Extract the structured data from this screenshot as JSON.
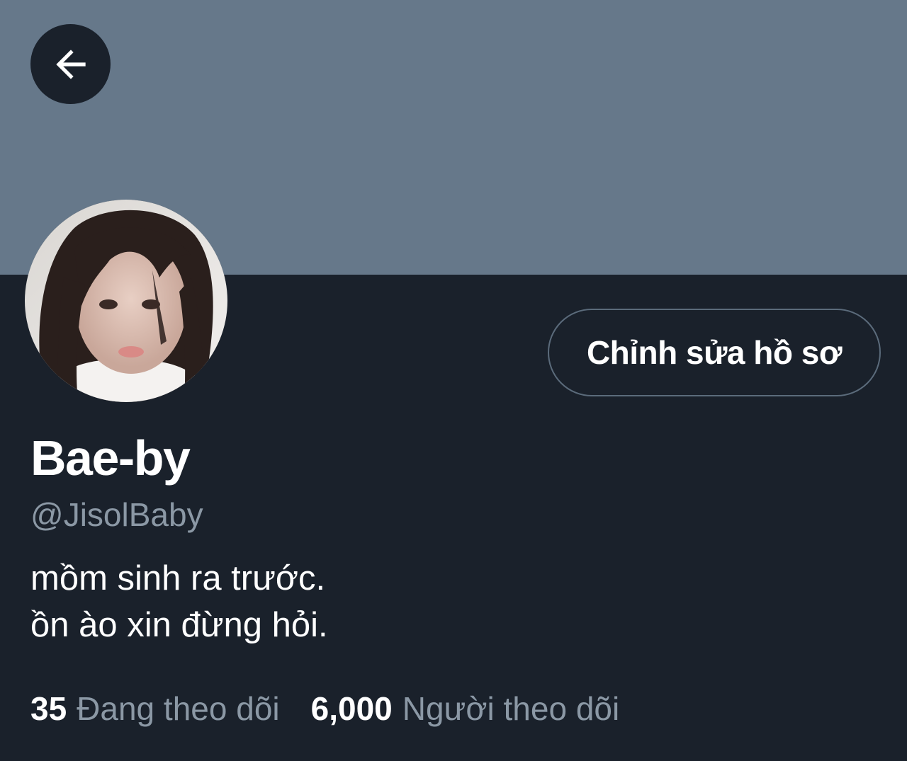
{
  "colors": {
    "banner": "#66788a",
    "background": "#1a212b",
    "primary_text": "#ffffff",
    "secondary_text": "#8b98a5",
    "button_border": "#5b6b7b"
  },
  "header": {
    "back_icon": "arrow-left-icon"
  },
  "profile": {
    "edit_button_label": "Chỉnh sửa hồ sơ",
    "display_name": "Bae-by",
    "handle": "@JisolBaby",
    "bio": [
      "mồm sinh ra trước.",
      "ồn ào xin đừng hỏi."
    ],
    "stats": {
      "following_count": "35",
      "following_label": "Đang theo dõi",
      "followers_count": "6,000",
      "followers_label": "Người theo dõi"
    }
  }
}
